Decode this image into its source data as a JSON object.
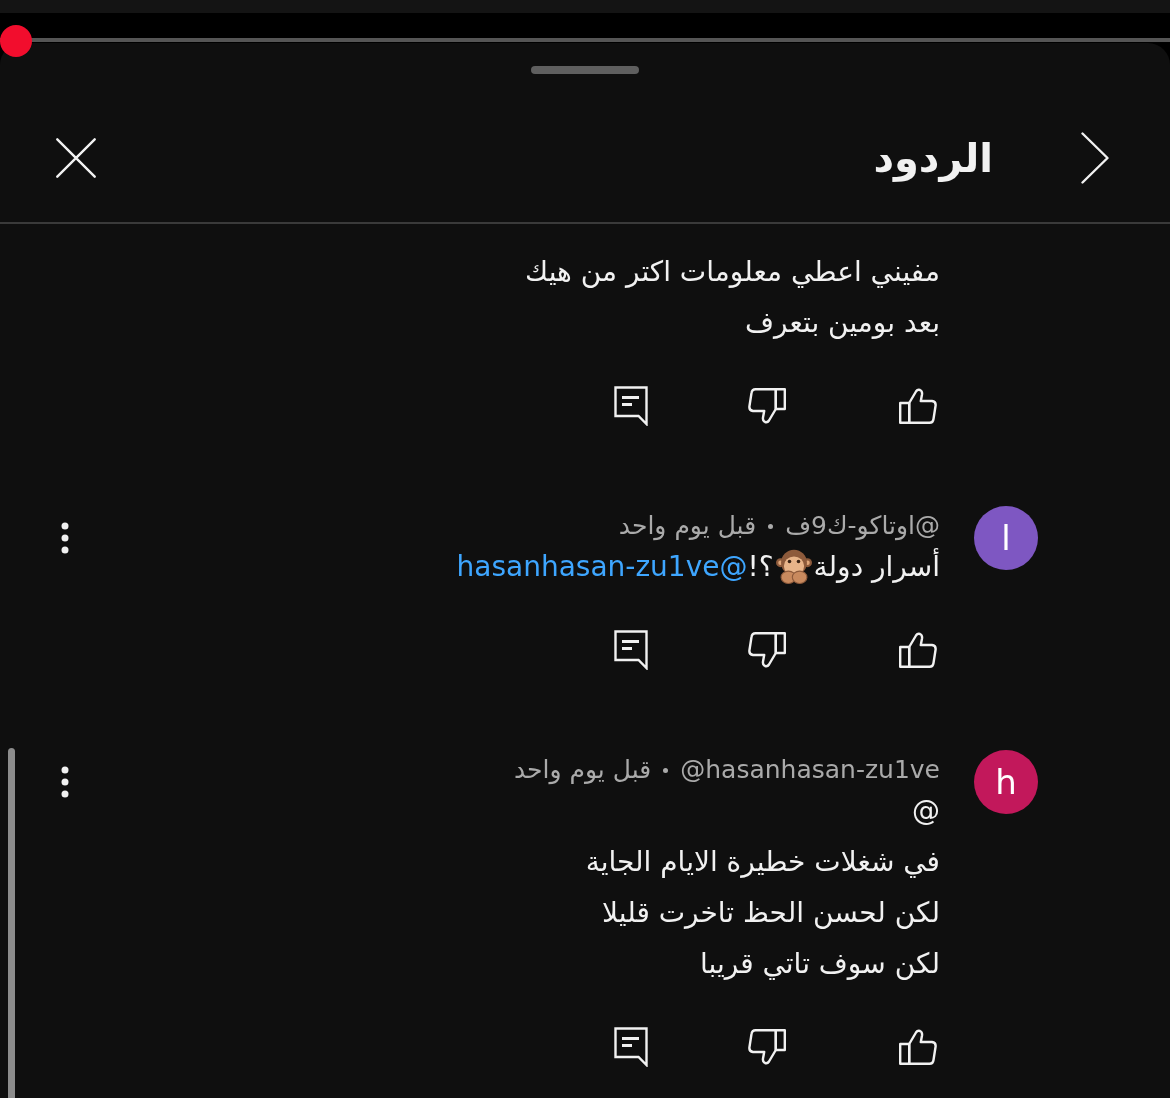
{
  "player": {
    "progress": {
      "level": 0.014
    }
  },
  "sheet": {
    "title": "الردود"
  },
  "comments": [
    {
      "body": [
        {
          "kind": "text",
          "text": "مفيني اعطي معلومات اكتر من هيك\nبعد بومين بتعرف"
        }
      ]
    },
    {
      "author": "@اوتاكو-ك9ف",
      "time": "قبل يوم واحد",
      "avatar": {
        "letter": "ا",
        "color": "#7e57c2"
      },
      "body": [
        {
          "kind": "text",
          "text": "أسرار دولة"
        },
        {
          "kind": "emoji"
        },
        {
          "kind": "text",
          "text": "؟!"
        },
        {
          "kind": "mention",
          "text": "@hasanhasan-zu1ve"
        }
      ]
    },
    {
      "author": "@hasanhasan-zu1ve",
      "time": "قبل يوم واحد",
      "avatar": {
        "letter": "h",
        "color": "#c2185b"
      },
      "body": [
        {
          "kind": "text",
          "text": "@\nفي شغلات خطيرة الايام الجاية\nلكن لحسن الحظ تاخرت قليلا\nلكن سوف تاتي قريبا"
        }
      ]
    }
  ]
}
